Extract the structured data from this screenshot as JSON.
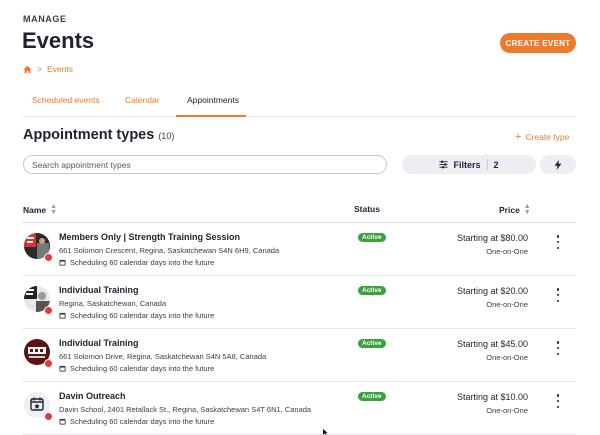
{
  "header": {
    "eyebrow": "MANAGE",
    "title": "Events",
    "create_event_label": "CREATE EVENT"
  },
  "breadcrumb": {
    "home_icon": "home-icon",
    "separator": ">",
    "current": "Events"
  },
  "tabs": [
    {
      "label": "Scheduled events",
      "active": false
    },
    {
      "label": "Calendar",
      "active": false
    },
    {
      "label": "Appointments",
      "active": true
    }
  ],
  "section": {
    "title": "Appointment types",
    "count": "(10)",
    "create_type_label": "Create type"
  },
  "search": {
    "placeholder": "Search appointment types",
    "value": ""
  },
  "filters": {
    "label": "Filters",
    "count": "2"
  },
  "table": {
    "columns": {
      "name": "Name",
      "status": "Status",
      "price": "Price"
    },
    "rows": [
      {
        "title": "Members Only | Strength Training Session",
        "address": "661 Solomon Crescent, Regina, Saskatchewan S4N 6H9, Canada",
        "schedule": "Scheduling 60 calendar days into the future",
        "status": "Active",
        "price": "Starting at $80.00",
        "type": "One-on-One"
      },
      {
        "title": "Individual Training",
        "address": "Regina, Saskatchewan, Canada",
        "schedule": "Scheduling 60 calendar days into the future",
        "status": "Active",
        "price": "Starting at $20.00",
        "type": "One-on-One"
      },
      {
        "title": "Individual Training",
        "address": "661 Solomon Drive, Regina, Saskatchewan S4N 5A8, Canada",
        "schedule": "Scheduling 60 calendar days into the future",
        "status": "Active",
        "price": "Starting at $45.00",
        "type": "One-on-One"
      },
      {
        "title": "Davin Outreach",
        "address": "Davin School, 2401 Retallack St., Regina, Saskatchewan S4T 6N1, Canada",
        "schedule": "Scheduling 60 calendar days into the future",
        "status": "Active",
        "price": "Starting at $10.00",
        "type": "One-on-One"
      }
    ]
  },
  "colors": {
    "accent": "#ee7a2c",
    "status_active": "#3aa13d",
    "badge": "#e33a3a"
  }
}
